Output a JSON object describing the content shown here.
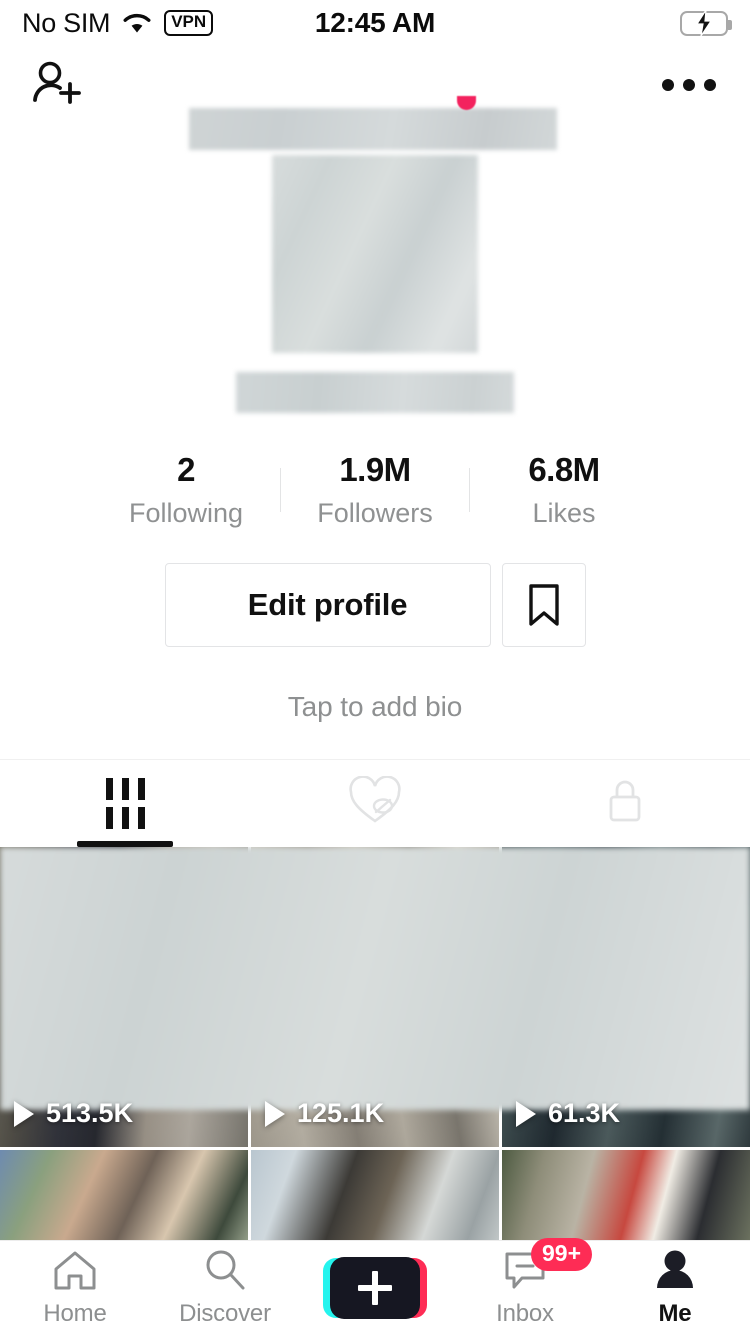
{
  "status_bar": {
    "carrier": "No SIM",
    "wifi_icon": "wifi-icon",
    "vpn_label": "VPN",
    "time": "12:45 AM",
    "battery_icon": "battery-charging-icon",
    "battery_color": "#32d74b"
  },
  "top_nav": {
    "add_friend_icon": "add-person-icon",
    "username_redacted": "",
    "notification_dot_color": "#f3225e",
    "more_icon": "ellipsis-icon"
  },
  "profile": {
    "avatar_redacted": "",
    "handle_redacted": "",
    "stats": [
      {
        "value": "2",
        "label": "Following"
      },
      {
        "value": "1.9M",
        "label": "Followers"
      },
      {
        "value": "6.8M",
        "label": "Likes"
      }
    ],
    "edit_profile_label": "Edit profile",
    "bookmark_icon": "bookmark-icon",
    "bio_placeholder": "Tap to add bio"
  },
  "content_tabs": [
    {
      "name": "videos",
      "icon": "grid-icon",
      "active": true
    },
    {
      "name": "liked",
      "icon": "heart-hidden-icon",
      "active": false
    },
    {
      "name": "private",
      "icon": "lock-icon",
      "active": false
    }
  ],
  "video_grid": {
    "row1": [
      {
        "play_count": "513.5K"
      },
      {
        "play_count": "125.1K"
      },
      {
        "play_count": "61.3K"
      }
    ],
    "row2": [
      {
        "play_count": ""
      },
      {
        "play_count": ""
      },
      {
        "play_count": ""
      }
    ]
  },
  "tab_bar": {
    "items": [
      {
        "label": "Home",
        "icon": "home-icon",
        "active": false
      },
      {
        "label": "Discover",
        "icon": "search-icon",
        "active": false
      },
      {
        "label": "",
        "icon": "create-plus-icon",
        "active": false
      },
      {
        "label": "Inbox",
        "icon": "message-icon",
        "active": false,
        "badge": "99+"
      },
      {
        "label": "Me",
        "icon": "person-icon",
        "active": true
      }
    ],
    "badge_color": "#fe2c55",
    "create_left_color": "#25f4ee",
    "create_right_color": "#fe2c55"
  }
}
